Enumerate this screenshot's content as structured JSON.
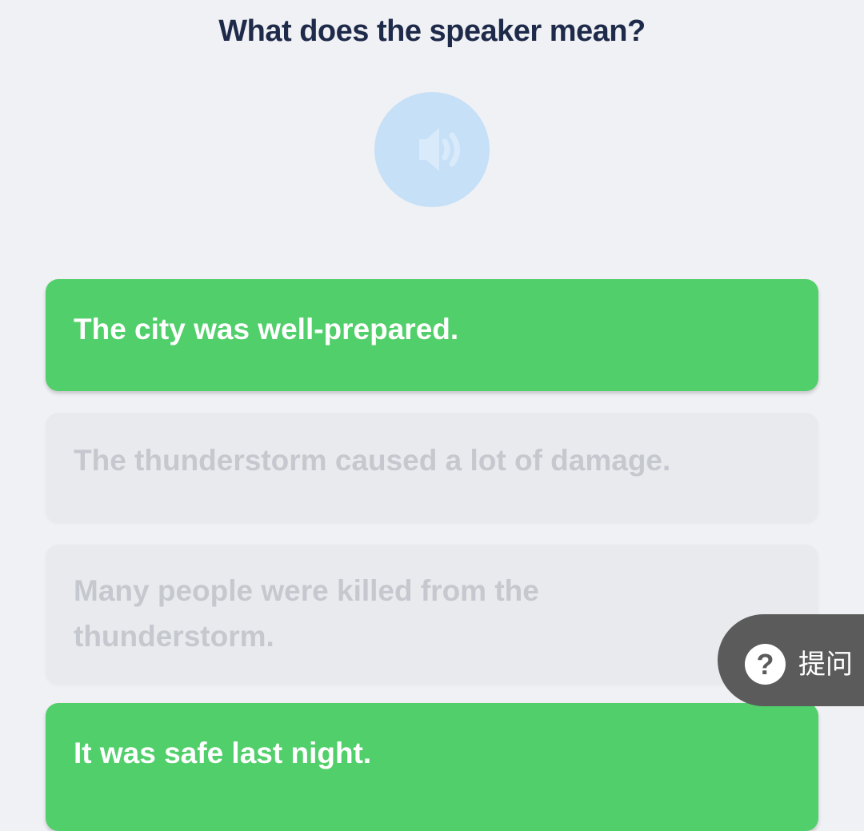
{
  "question": {
    "title": "What does the speaker mean?"
  },
  "audio": {
    "icon": "speaker-icon",
    "color": "#c6e0f7"
  },
  "options": [
    {
      "label": "The city was well-prepared.",
      "state": "selected"
    },
    {
      "label": "The thunderstorm caused a lot of damage.",
      "state": "disabled"
    },
    {
      "label": "Many people were killed from the thunderstorm.",
      "state": "disabled"
    },
    {
      "label": "It was safe last night.",
      "state": "selected"
    }
  ],
  "ask_button": {
    "icon": "question-icon",
    "icon_glyph": "?",
    "label": "提问"
  },
  "colors": {
    "background": "#f0f1f4",
    "selected": "#51cf6a",
    "disabled": "#e9eaed",
    "disabled_text": "#c5c8ce",
    "title": "#1e2a4a",
    "ask_button": "#5b5b5b"
  }
}
